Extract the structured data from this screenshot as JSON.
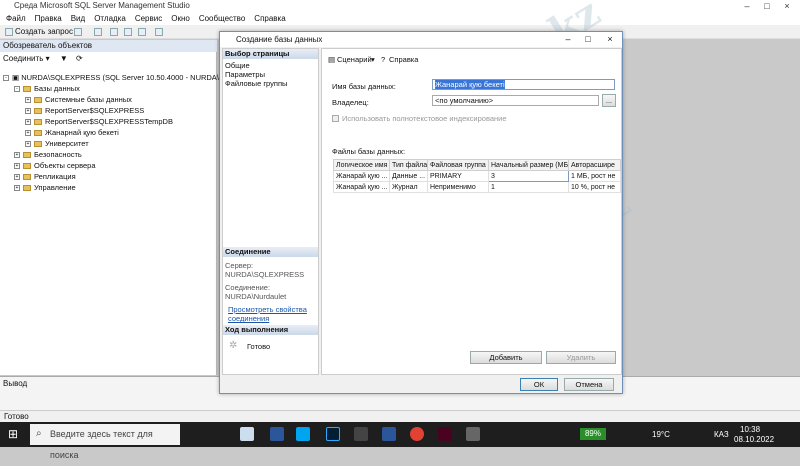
{
  "window": {
    "title": "Среда Microsoft SQL Server Management Studio"
  },
  "menu": [
    "Файл",
    "Правка",
    "Вид",
    "Отладка",
    "Сервис",
    "Окно",
    "Сообщество",
    "Справка"
  ],
  "toolbar": {
    "new_query": "Создать запрос"
  },
  "object_explorer": {
    "title": "Обозреватель объектов",
    "connect": "Соединить",
    "tree": [
      {
        "label": "NURDA\\SQLEXPRESS (SQL Server 10.50.4000 - NURDA\\Nurdaul"
      },
      {
        "label": "Базы данных"
      },
      {
        "label": "Системные базы данных"
      },
      {
        "label": "ReportServer$SQLEXPRESS"
      },
      {
        "label": "ReportServer$SQLEXPRESSTempDB"
      },
      {
        "label": "Жанарнай қую бекеті"
      },
      {
        "label": "Университет"
      },
      {
        "label": "Безопасность"
      },
      {
        "label": "Объекты сервера"
      },
      {
        "label": "Репликация"
      },
      {
        "label": "Управление"
      }
    ]
  },
  "output": {
    "title": "Вывод"
  },
  "status": {
    "text": "Готово"
  },
  "dialog": {
    "title": "Создание базы данных",
    "select_page": "Выбор страницы",
    "pages": [
      "Общие",
      "Параметры",
      "Файловые группы"
    ],
    "connection_header": "Соединение",
    "server_label": "Сервер:",
    "server_value": "NURDA\\SQLEXPRESS",
    "connection_label": "Соединение:",
    "connection_value": "NURDA\\Nurdaulet",
    "view_props_link_1": "Просмотреть свойства",
    "view_props_link_2": "соединения",
    "progress_header": "Ход выполнения",
    "progress_status": "Готово",
    "script_btn": "Сценарий",
    "help_btn": "Справка",
    "db_name_label": "Имя базы данных:",
    "db_name_value": "Жанарай қую бекеті",
    "owner_label": "Владелец:",
    "owner_value": "<по умолчанию>",
    "browse_btn": "...",
    "fulltext_label": "Использовать полнотекстовое индексирование",
    "files_label": "Файлы базы данных:",
    "columns": [
      "Логическое имя",
      "Тип файла",
      "Файловая группа",
      "Начальный размер (МБ)",
      "Авторасшире"
    ],
    "rows": [
      [
        "Жанарай қую ...",
        "Данные ...",
        "PRIMARY",
        "3",
        "1 МБ, рост не"
      ],
      [
        "Жанарай қую ...",
        "Журнал",
        "Неприменимо",
        "1",
        "10 %, рост не"
      ]
    ],
    "add_btn": "Добавить",
    "remove_btn": "Удалить",
    "ok_btn": "ОК",
    "cancel_btn": "Отмена"
  },
  "taskbar": {
    "search_placeholder": "Введите здесь текст для поиска",
    "battery": "89%",
    "weather": "19°C",
    "lang": "КАЗ",
    "time": "10:38",
    "date": "08.10.2022"
  },
  "watermark": "Stud.kz"
}
